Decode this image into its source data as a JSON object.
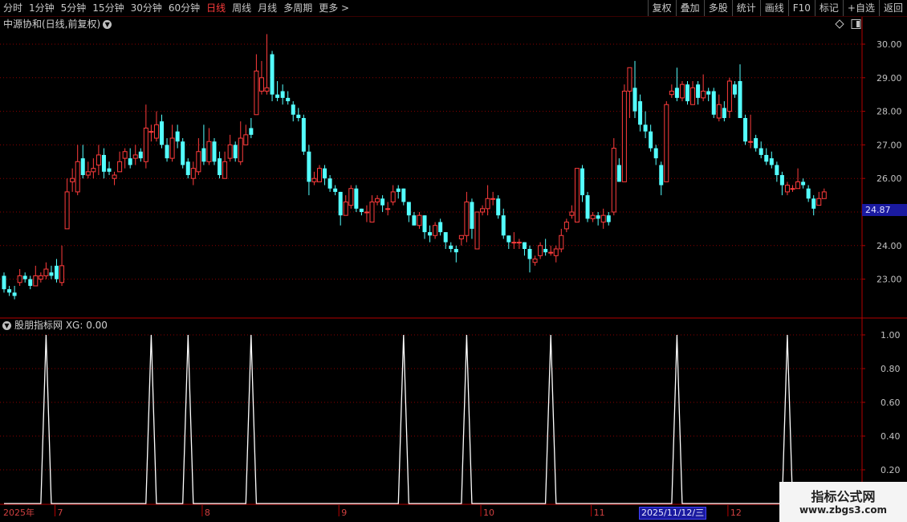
{
  "toolbar": {
    "periods": [
      "分时",
      "1分钟",
      "5分钟",
      "15分钟",
      "30分钟",
      "60分钟",
      "日线",
      "周线",
      "月线",
      "多周期",
      "更多 >"
    ],
    "active_period": "日线",
    "right_buttons": [
      "复权",
      "叠加",
      "多股",
      "统计",
      "画线",
      "F10",
      "标记",
      "+自选",
      "返回"
    ]
  },
  "main_panel": {
    "title": "中源协和(日线,前复权)",
    "current_price_label": "24.87"
  },
  "indicator_panel": {
    "title": "股朋指标网  XG: 0.00"
  },
  "x_axis": {
    "labels": [
      "2025年",
      "7",
      "8",
      "9",
      "10",
      "11",
      "12"
    ],
    "selected_date": "2025/11/12/三"
  },
  "price_axis_labels": [
    "30.00",
    "29.00",
    "28.00",
    "27.00",
    "26.00",
    "25.00",
    "24.00",
    "23.00"
  ],
  "indicator_axis_labels": [
    "1.00",
    "0.80",
    "0.60",
    "0.40",
    "0.20"
  ],
  "watermark": {
    "title": "指标公式网",
    "url": "www.zbgs3.com"
  },
  "colors": {
    "up": "#ff3c3c",
    "down": "#54ffff",
    "grid": "#8b0000",
    "signal": "#ffffff",
    "border": "#b40000"
  },
  "chart_data": [
    {
      "type": "candlestick",
      "title": "中源协和(日线,前复权)",
      "ylim": [
        22.0,
        30.5
      ],
      "y_ticks": [
        23,
        24,
        25,
        26,
        27,
        28,
        29,
        30
      ],
      "candles": [
        [
          23.1,
          22.7,
          23.2,
          22.6
        ],
        [
          22.7,
          22.6,
          22.8,
          22.5
        ],
        [
          22.6,
          22.5,
          22.8,
          22.4
        ],
        [
          22.9,
          23.1,
          23.3,
          22.8
        ],
        [
          23.1,
          23.0,
          23.2,
          22.9
        ],
        [
          23.0,
          22.8,
          23.1,
          22.7
        ],
        [
          22.8,
          23.1,
          23.4,
          22.8
        ],
        [
          23.0,
          23.1,
          23.2,
          22.9
        ],
        [
          23.1,
          23.3,
          23.5,
          23.0
        ],
        [
          23.2,
          23.1,
          23.4,
          23.0
        ],
        [
          23.4,
          23.0,
          23.6,
          22.9
        ],
        [
          22.9,
          23.4,
          24.0,
          22.8
        ],
        [
          24.5,
          25.6,
          26.0,
          24.5
        ],
        [
          25.9,
          26.0,
          26.3,
          25.6
        ],
        [
          25.6,
          26.5,
          27.0,
          25.5
        ],
        [
          26.6,
          26.1,
          27.0,
          26.0
        ],
        [
          26.1,
          26.2,
          26.5,
          26.0
        ],
        [
          26.2,
          26.3,
          26.6,
          26.0
        ],
        [
          26.4,
          26.7,
          27.0,
          26.1
        ],
        [
          26.7,
          26.2,
          26.9,
          26.0
        ],
        [
          26.3,
          26.2,
          26.5,
          26.1
        ],
        [
          26.0,
          26.1,
          26.2,
          25.8
        ],
        [
          26.2,
          26.5,
          26.8,
          26.2
        ],
        [
          26.6,
          26.8,
          26.9,
          26.3
        ],
        [
          26.6,
          26.4,
          26.9,
          26.3
        ],
        [
          26.6,
          26.7,
          27.0,
          26.4
        ],
        [
          26.8,
          26.6,
          26.9,
          26.5
        ],
        [
          26.5,
          27.5,
          28.2,
          26.3
        ],
        [
          27.4,
          27.4,
          27.6,
          27.1
        ],
        [
          27.2,
          27.6,
          28.0,
          27.1
        ],
        [
          27.7,
          27.0,
          27.9,
          26.9
        ],
        [
          27.0,
          26.6,
          27.2,
          26.5
        ],
        [
          26.6,
          27.2,
          27.6,
          26.5
        ],
        [
          27.4,
          27.1,
          27.6,
          26.9
        ],
        [
          27.1,
          26.4,
          27.2,
          26.3
        ],
        [
          26.5,
          26.1,
          26.6,
          26.0
        ],
        [
          26.0,
          26.3,
          26.5,
          25.8
        ],
        [
          26.2,
          26.8,
          27.2,
          26.1
        ],
        [
          26.9,
          26.5,
          27.6,
          26.4
        ],
        [
          26.5,
          27.1,
          27.5,
          26.4
        ],
        [
          27.1,
          26.5,
          27.2,
          26.4
        ],
        [
          26.6,
          26.1,
          26.8,
          26.0
        ],
        [
          26.0,
          26.5,
          26.8,
          26.0
        ],
        [
          26.6,
          27.0,
          27.3,
          26.5
        ],
        [
          27.0,
          26.6,
          27.1,
          26.5
        ],
        [
          26.5,
          27.2,
          27.7,
          26.4
        ],
        [
          27.0,
          27.3,
          27.6,
          27.0
        ],
        [
          27.5,
          27.3,
          27.8,
          27.2
        ],
        [
          27.9,
          29.2,
          29.7,
          27.9
        ],
        [
          28.6,
          29.0,
          29.5,
          28.5
        ],
        [
          28.6,
          28.7,
          30.3,
          28.5
        ],
        [
          29.7,
          28.5,
          29.8,
          28.3
        ],
        [
          28.5,
          28.4,
          28.9,
          28.3
        ],
        [
          28.6,
          28.4,
          28.8,
          28.2
        ],
        [
          28.4,
          28.3,
          28.6,
          28.2
        ],
        [
          28.2,
          27.9,
          28.3,
          27.7
        ],
        [
          27.9,
          27.8,
          28.1,
          27.7
        ],
        [
          27.8,
          26.8,
          27.9,
          26.7
        ],
        [
          26.8,
          25.9,
          27.0,
          25.5
        ],
        [
          25.9,
          26.0,
          26.2,
          25.8
        ],
        [
          25.9,
          26.3,
          26.4,
          25.9
        ],
        [
          26.3,
          26.0,
          26.4,
          25.8
        ],
        [
          26.0,
          25.7,
          26.1,
          25.6
        ],
        [
          25.7,
          25.6,
          25.8,
          25.5
        ],
        [
          25.6,
          24.9,
          25.6,
          24.6
        ],
        [
          24.9,
          25.3,
          25.5,
          24.9
        ],
        [
          25.2,
          25.7,
          25.8,
          25.1
        ],
        [
          25.7,
          25.1,
          25.8,
          25.0
        ],
        [
          25.1,
          25.0,
          25.1,
          24.9
        ],
        [
          25.0,
          25.0,
          25.2,
          24.7
        ],
        [
          24.7,
          25.3,
          25.5,
          24.7
        ],
        [
          25.3,
          25.4,
          25.5,
          25.2
        ],
        [
          25.4,
          25.2,
          25.5,
          25.0
        ],
        [
          25.1,
          25.1,
          25.3,
          24.9
        ],
        [
          25.3,
          25.6,
          25.8,
          25.2
        ],
        [
          25.7,
          25.6,
          25.8,
          25.4
        ],
        [
          25.7,
          25.3,
          25.7,
          25.2
        ],
        [
          25.3,
          24.9,
          25.3,
          24.7
        ],
        [
          24.9,
          24.6,
          25.0,
          24.6
        ],
        [
          24.6,
          24.9,
          25.0,
          24.5
        ],
        [
          24.9,
          24.4,
          24.9,
          24.2
        ],
        [
          24.4,
          24.3,
          24.6,
          24.1
        ],
        [
          24.3,
          24.6,
          24.7,
          24.2
        ],
        [
          24.7,
          24.4,
          24.8,
          24.3
        ],
        [
          24.4,
          24.1,
          24.4,
          23.9
        ],
        [
          24.0,
          23.9,
          24.1,
          23.8
        ],
        [
          23.9,
          23.8,
          24.0,
          23.5
        ],
        [
          24.2,
          24.3,
          24.3,
          24.0
        ],
        [
          24.3,
          25.3,
          25.6,
          24.1
        ],
        [
          25.3,
          24.5,
          25.4,
          24.2
        ],
        [
          23.9,
          25.0,
          25.0,
          23.9
        ],
        [
          25.0,
          25.1,
          25.2,
          24.9
        ],
        [
          25.1,
          25.4,
          25.8,
          24.9
        ],
        [
          25.4,
          25.4,
          25.6,
          25.2
        ],
        [
          25.4,
          24.9,
          25.5,
          24.8
        ],
        [
          24.9,
          24.3,
          25.1,
          24.2
        ],
        [
          24.3,
          24.1,
          24.3,
          23.9
        ],
        [
          24.1,
          24.1,
          24.4,
          23.9
        ],
        [
          24.1,
          24.1,
          24.2,
          23.9
        ],
        [
          24.1,
          23.9,
          24.1,
          23.7
        ],
        [
          23.9,
          23.6,
          24.0,
          23.2
        ],
        [
          23.5,
          23.6,
          23.7,
          23.4
        ],
        [
          23.7,
          24.0,
          24.1,
          23.6
        ],
        [
          23.9,
          23.8,
          24.2,
          23.7
        ],
        [
          23.8,
          23.8,
          24.0,
          23.7
        ],
        [
          23.7,
          23.9,
          24.0,
          23.5
        ],
        [
          23.9,
          24.3,
          24.5,
          23.8
        ],
        [
          24.5,
          24.7,
          24.8,
          24.4
        ],
        [
          24.9,
          25.0,
          25.2,
          24.8
        ],
        [
          24.7,
          26.3,
          26.3,
          24.7
        ],
        [
          26.3,
          25.5,
          26.4,
          25.3
        ],
        [
          25.5,
          24.8,
          25.6,
          24.7
        ],
        [
          24.8,
          24.9,
          25.0,
          24.7
        ],
        [
          24.9,
          24.8,
          25.0,
          24.6
        ],
        [
          24.7,
          24.9,
          25.1,
          24.5
        ],
        [
          24.9,
          24.7,
          25.0,
          24.6
        ],
        [
          25.0,
          26.9,
          27.2,
          24.9
        ],
        [
          26.4,
          25.9,
          26.6,
          25.9
        ],
        [
          25.9,
          28.6,
          28.8,
          25.9
        ],
        [
          28.6,
          29.3,
          29.3,
          27.8
        ],
        [
          28.7,
          28.0,
          29.5,
          27.8
        ],
        [
          28.3,
          27.6,
          28.5,
          27.4
        ],
        [
          27.6,
          27.4,
          28.0,
          27.2
        ],
        [
          27.4,
          26.9,
          27.6,
          26.8
        ],
        [
          26.9,
          26.6,
          27.0,
          26.4
        ],
        [
          26.4,
          25.8,
          26.5,
          25.5
        ],
        [
          25.9,
          28.2,
          28.3,
          25.9
        ],
        [
          28.5,
          28.6,
          28.8,
          28.4
        ],
        [
          28.7,
          28.4,
          29.3,
          28.3
        ],
        [
          28.4,
          28.8,
          28.9,
          28.3
        ],
        [
          28.8,
          28.3,
          28.9,
          28.2
        ],
        [
          28.2,
          28.7,
          28.9,
          28.2
        ],
        [
          28.8,
          28.4,
          28.9,
          28.2
        ],
        [
          28.4,
          28.6,
          29.1,
          28.3
        ],
        [
          28.6,
          28.5,
          28.7,
          28.3
        ],
        [
          28.6,
          27.9,
          28.7,
          27.8
        ],
        [
          27.8,
          28.2,
          28.5,
          27.7
        ],
        [
          28.1,
          27.8,
          28.3,
          27.7
        ],
        [
          28.0,
          28.9,
          29.0,
          27.8
        ],
        [
          28.8,
          28.5,
          28.9,
          28.4
        ],
        [
          28.9,
          27.8,
          29.4,
          27.8
        ],
        [
          27.8,
          27.1,
          27.9,
          27.0
        ],
        [
          27.1,
          27.1,
          27.9,
          26.9
        ],
        [
          27.2,
          26.9,
          27.3,
          26.8
        ],
        [
          26.9,
          26.7,
          27.1,
          26.6
        ],
        [
          26.7,
          26.5,
          26.9,
          26.4
        ],
        [
          26.6,
          26.4,
          26.8,
          26.3
        ],
        [
          26.4,
          26.1,
          26.5,
          25.9
        ],
        [
          26.1,
          25.8,
          26.2,
          25.5
        ],
        [
          25.6,
          25.8,
          25.9,
          25.5
        ],
        [
          25.7,
          25.7,
          25.8,
          25.6
        ],
        [
          25.7,
          25.9,
          26.3,
          25.7
        ],
        [
          25.9,
          25.8,
          26.0,
          25.7
        ],
        [
          25.7,
          25.4,
          25.8,
          25.3
        ],
        [
          25.4,
          25.1,
          25.5,
          24.9
        ],
        [
          25.2,
          25.4,
          25.6,
          25.2
        ],
        [
          25.4,
          25.6,
          25.7,
          25.4
        ]
      ]
    },
    {
      "type": "line",
      "title": "股朋指标网  XG: 0.00",
      "ylim": [
        0,
        1.05
      ],
      "y_ticks": [
        0.2,
        0.4,
        0.6,
        0.8,
        1.0
      ],
      "signal_bar_indexes": [
        8,
        28,
        35,
        47,
        76,
        88,
        104,
        128,
        149
      ],
      "signal_value": 1.0,
      "baseline_value": 0.0
    }
  ]
}
